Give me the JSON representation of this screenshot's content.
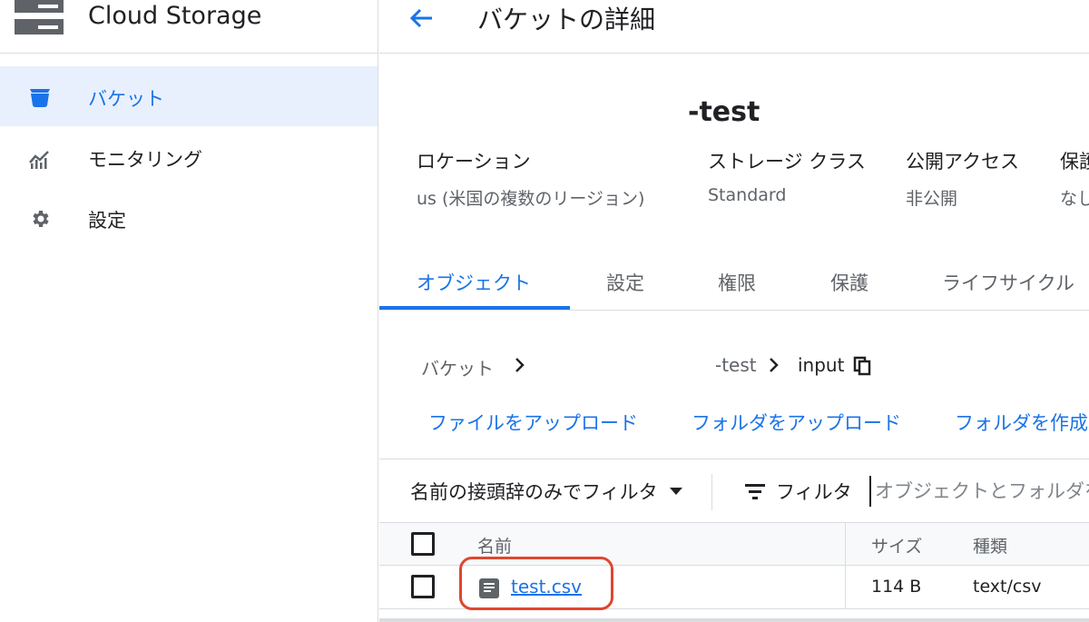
{
  "sidebar": {
    "app_title": "Cloud Storage",
    "items": [
      {
        "label": "バケット",
        "icon": "bucket-icon",
        "active": true
      },
      {
        "label": "モニタリング",
        "icon": "monitoring-icon",
        "active": false
      },
      {
        "label": "設定",
        "icon": "gear-icon",
        "active": false
      }
    ]
  },
  "header": {
    "title": "バケットの詳細"
  },
  "bucket": {
    "name": "-test",
    "meta": [
      {
        "key": "ロケーション",
        "value": "us (米国の複数のリージョン)"
      },
      {
        "key": "ストレージ クラス",
        "value": "Standard"
      },
      {
        "key": "公開アクセス",
        "value": "非公開"
      },
      {
        "key": "保護",
        "value": "なし"
      }
    ]
  },
  "tabs": [
    {
      "label": "オブジェクト",
      "active": true
    },
    {
      "label": "設定",
      "active": false
    },
    {
      "label": "権限",
      "active": false
    },
    {
      "label": "保護",
      "active": false
    },
    {
      "label": "ライフサイクル",
      "active": false
    }
  ],
  "breadcrumb": {
    "root": "バケット",
    "bucket": "-test",
    "folder": "input"
  },
  "actions": [
    "ファイルをアップロード",
    "フォルダをアップロード",
    "フォルダを作成"
  ],
  "filter": {
    "prefix_label": "名前の接頭辞のみでフィルタ",
    "filter_label": "フィルタ",
    "search_placeholder": "オブジェクトとフォルダをフィルタ"
  },
  "table": {
    "columns": [
      "名前",
      "サイズ",
      "種類"
    ],
    "rows": [
      {
        "name": "test.csv",
        "size": "114 B",
        "type": "text/csv"
      }
    ]
  },
  "colors": {
    "accent": "#1a73e8",
    "highlight": "#e0462f"
  }
}
